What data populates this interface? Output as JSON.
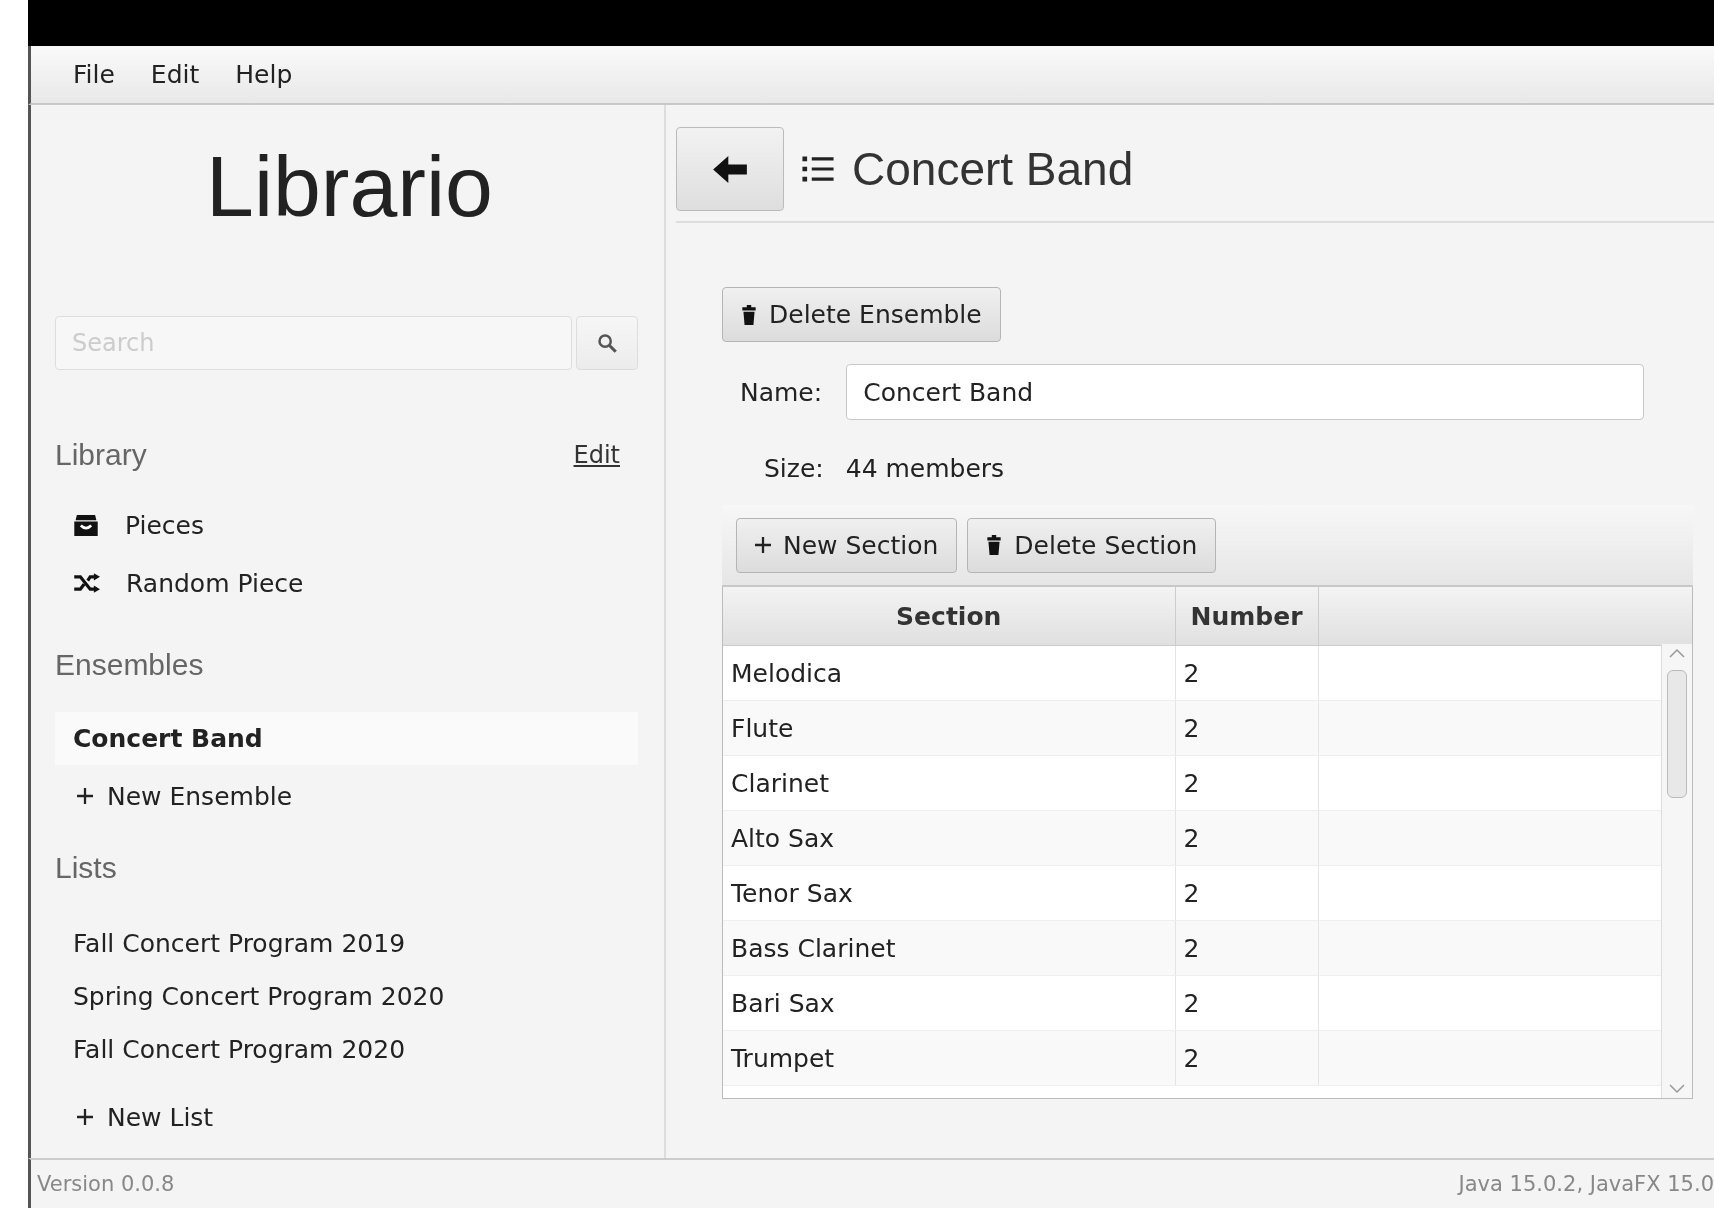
{
  "menu": [
    "File",
    "Edit",
    "Help"
  ],
  "sidebar": {
    "title": "Librario",
    "search": {
      "placeholder": "Search"
    },
    "library": {
      "heading": "Library",
      "edit_link": "Edit",
      "items": [
        {
          "label": "Pieces",
          "kind": "pieces"
        },
        {
          "label": "Random Piece",
          "kind": "random"
        }
      ]
    },
    "ensembles": {
      "heading": "Ensembles",
      "items": [
        {
          "label": "Concert Band",
          "selected": true
        }
      ],
      "add": "New Ensemble"
    },
    "lists": {
      "heading": "Lists",
      "items": [
        {
          "label": "Fall Concert Program 2019",
          "selected": false
        },
        {
          "label": "Spring Concert Program 2020",
          "selected": false
        },
        {
          "label": "Fall Concert Program 2020",
          "selected": false
        }
      ],
      "add": "New List"
    }
  },
  "main": {
    "title": "Concert Band",
    "delete_button": "Delete Ensemble",
    "name_label": "Name:",
    "name_value": "Concert Band",
    "size_label": "Size:",
    "size_value": "44 members",
    "toolbar": [
      "New Section",
      "Delete Section"
    ],
    "table": {
      "columns": [
        "Section",
        "Number"
      ],
      "rows": [
        [
          "Melodica",
          "2"
        ],
        [
          "Flute",
          "2"
        ],
        [
          "Clarinet",
          "2"
        ],
        [
          "Alto Sax",
          "2"
        ],
        [
          "Tenor Sax",
          "2"
        ],
        [
          "Bass Clarinet",
          "2"
        ],
        [
          "Bari Sax",
          "2"
        ],
        [
          "Trumpet",
          "2"
        ]
      ]
    }
  },
  "status_bar": {
    "left": "Version 0.0.8",
    "right": "Java 15.0.2, JavaFX 15.0"
  }
}
